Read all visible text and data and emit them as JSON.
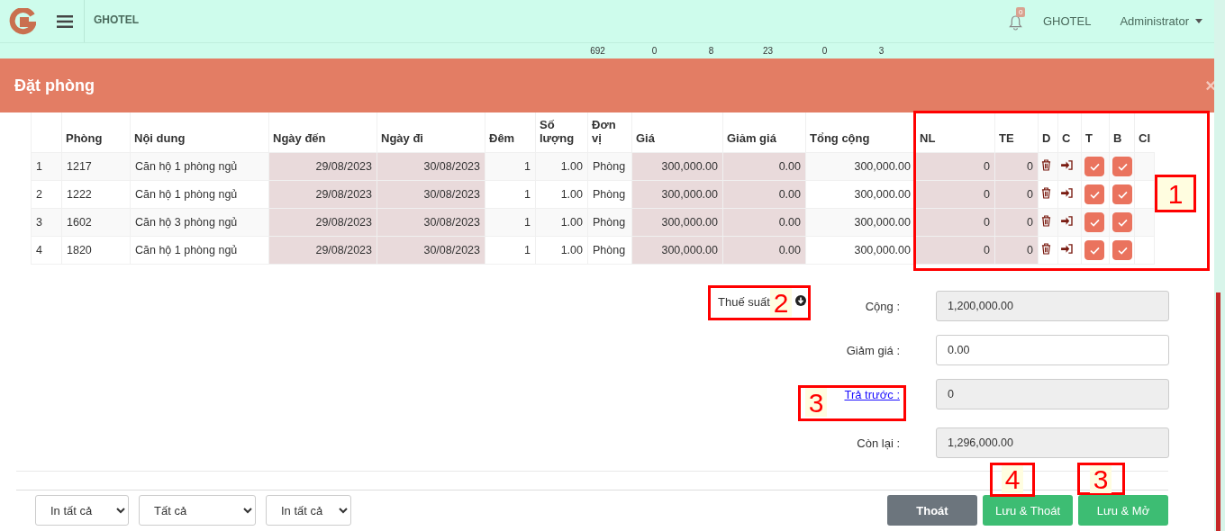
{
  "topbar": {
    "brand": "GHOTEL",
    "notifications": "0",
    "hotel": "GHOTEL",
    "user": "Administrator"
  },
  "stats": [
    "692",
    "0",
    "8",
    "23",
    "0",
    "3"
  ],
  "modal": {
    "title": "Đặt phòng",
    "close": "×"
  },
  "table": {
    "columns": [
      {
        "shaded": false
      },
      {
        "label": "Phòng",
        "shaded": false
      },
      {
        "label": "Nội dung",
        "shaded": false
      },
      {
        "label": "Ngày đến",
        "shaded": true
      },
      {
        "label": "Ngày đi",
        "shaded": true
      },
      {
        "label": "Đêm",
        "shaded": false
      },
      {
        "label": "Số lượng",
        "shaded": false
      },
      {
        "label": "Đơn vị",
        "shaded": false
      },
      {
        "label": "Giá",
        "shaded": true
      },
      {
        "label": "Giảm giá",
        "shaded": true
      },
      {
        "label": "Tổng cộng",
        "shaded": false
      },
      {
        "label": "NL",
        "shaded": true
      },
      {
        "label": "TE",
        "shaded": true
      },
      {
        "label": "D",
        "shaded": false
      },
      {
        "label": "C",
        "shaded": false
      },
      {
        "label": "T",
        "shaded": false
      },
      {
        "label": "B",
        "shaded": false
      },
      {
        "label": "CI",
        "shaded": false
      }
    ],
    "rows": [
      {
        "cells": [
          "1",
          "1217",
          "Căn hộ 1 phòng ngủ",
          "29/08/2023",
          "30/08/2023",
          "1",
          "1.00",
          "Phòng",
          "300,000.00",
          "0.00",
          "300,000.00",
          "0",
          "0"
        ],
        "t_checked": true,
        "b_checked": true
      },
      {
        "cells": [
          "2",
          "1222",
          "Căn hộ 1 phòng ngủ",
          "29/08/2023",
          "30/08/2023",
          "1",
          "1.00",
          "Phòng",
          "300,000.00",
          "0.00",
          "300,000.00",
          "0",
          "0"
        ],
        "t_checked": true,
        "b_checked": true
      },
      {
        "cells": [
          "3",
          "1602",
          "Căn hộ 3 phòng ngủ",
          "29/08/2023",
          "30/08/2023",
          "1",
          "1.00",
          "Phòng",
          "300,000.00",
          "0.00",
          "300,000.00",
          "0",
          "0"
        ],
        "t_checked": true,
        "b_checked": true
      },
      {
        "cells": [
          "4",
          "1820",
          "Căn hộ 1 phòng ngủ",
          "29/08/2023",
          "30/08/2023",
          "1",
          "1.00",
          "Phòng",
          "300,000.00",
          "0.00",
          "300,000.00",
          "0",
          "0"
        ],
        "t_checked": true,
        "b_checked": true
      }
    ]
  },
  "tax": {
    "label": "Thuế suất"
  },
  "summary": [
    {
      "label": "Cộng :",
      "value": "1,200,000.00",
      "readonly": true,
      "link": false
    },
    {
      "label": "Giảm giá :",
      "value": "0.00",
      "readonly": false,
      "link": false
    },
    {
      "label": "Trả trước :",
      "value": "0",
      "readonly": true,
      "link": true
    },
    {
      "label": "Còn lại :",
      "value": "1,296,000.00",
      "readonly": true,
      "link": false
    }
  ],
  "footer": {
    "selects": [
      "In tất cả",
      "Tất cả",
      "In tất cả"
    ],
    "buttons": [
      {
        "label": "Thoát",
        "kind": "secondary"
      },
      {
        "label": "Lưu & Thoát",
        "kind": "success"
      },
      {
        "label": "Lưu & Mở",
        "kind": "success"
      }
    ]
  },
  "annotations": [
    {
      "label": "1"
    },
    {
      "label": "2"
    },
    {
      "label": "3"
    },
    {
      "label": "4"
    },
    {
      "label": "3"
    }
  ]
}
